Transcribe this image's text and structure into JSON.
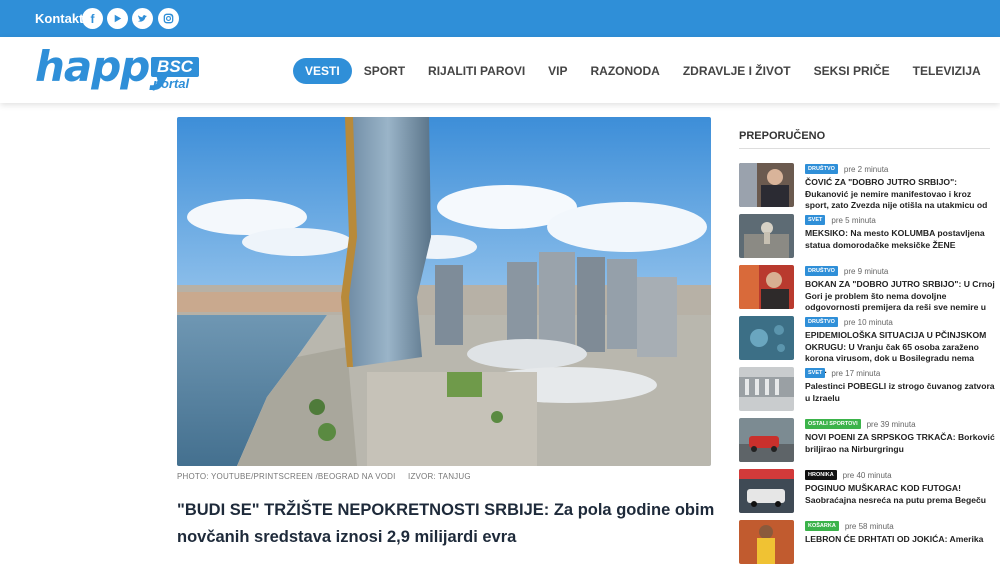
{
  "topbar": {
    "kontakt": "Kontakt",
    "social": [
      "facebook-icon",
      "youtube-icon",
      "twitter-icon",
      "instagram-icon"
    ]
  },
  "logo": {
    "word": "happy",
    "badge": "BSC",
    "sub": "portal"
  },
  "nav": [
    {
      "label": "VESTI",
      "active": true
    },
    {
      "label": "SPORT"
    },
    {
      "label": "RIJALITI PAROVI"
    },
    {
      "label": "VIP"
    },
    {
      "label": "RAZONODA"
    },
    {
      "label": "ZDRAVLJE I ŽIVOT"
    },
    {
      "label": "SEKSI PRIČE"
    },
    {
      "label": "TELEVIZIJA"
    }
  ],
  "article": {
    "photo_credit": "PHOTO: YOUTUBE/PRINTSCREEN /BEOGRAD NA VODI",
    "source": "IZVOR: TANJUG",
    "headline": "\"BUDI SE\" TRŽIŠTE NEPOKRETNOSTI SRBIJE: Za pola godine obim novčanih sredstava iznosi 2,9 milijardi evra"
  },
  "sidebar": {
    "title": "PREPORUČENO",
    "items": [
      {
        "badge": "DRUŠTVO",
        "color": "#2f8fd8",
        "time": "pre 2 minuta",
        "title": "ČOVIĆ ZA \"DOBRO JUTRO SRBIJO\": Đukanović je nemire manifestovao i kroz sport, zato Zvezda nije otišla na utakmicu od ..."
      },
      {
        "badge": "SVET",
        "color": "#2f8fd8",
        "time": "pre 5 minuta",
        "title": "MEKSIKO: Na mesto KOLUMBA postavljena statua domorodačke meksičke ŽENE"
      },
      {
        "badge": "DRUŠTVO",
        "color": "#2f8fd8",
        "time": "pre 9 minuta",
        "title": "BOKAN ZA \"DOBRO JUTRO SRBIJO\": U Crnoj Gori je problem što nema dovoljne odgovornosti premijera da reši sve nemire u ..."
      },
      {
        "badge": "DRUŠTVO",
        "color": "#2f8fd8",
        "time": "pre 10 minuta",
        "title": "EPIDEMIOLOŠKA SITUACIJA U PČINJSKOM OKRUGU: U Vranju čak 65 osoba zaraženo korona virusom, dok u Bosilegradu nema nov..."
      },
      {
        "badge": "SVET",
        "color": "#2f8fd8",
        "time": "pre 17 minuta",
        "title": "Palestinci POBEGLI iz strogo čuvanog zatvora u Izraelu"
      },
      {
        "badge": "OSTALI SPORTOVI",
        "color": "#3bb34a",
        "time": "pre 39 minuta",
        "title": "NOVI POENI ZA SRPSKOG TRKAČA: Borković briljirao na Nirburgringu"
      },
      {
        "badge": "HRONIKA",
        "color": "#111111",
        "time": "pre 40 minuta",
        "title": "POGINUO MUŠKARAC KOD FUTOGA! Saobraćajna nesreća na putu prema Begeču"
      },
      {
        "badge": "KOŠARKA",
        "color": "#3bb34a",
        "time": "pre 58 minuta",
        "title": "LEBRON ĆE DRHTATI OD JOKIĆA: Amerika"
      }
    ]
  }
}
